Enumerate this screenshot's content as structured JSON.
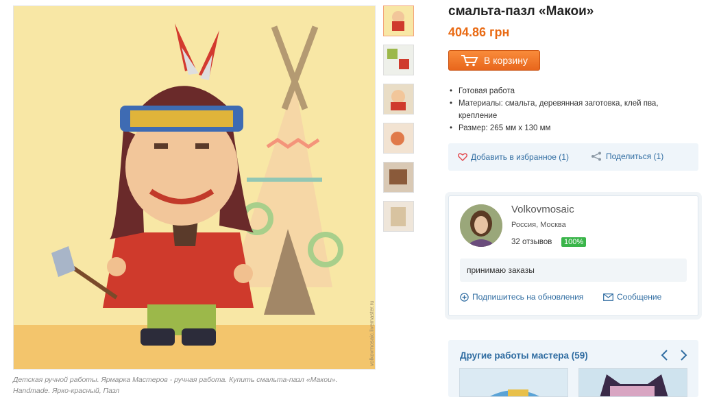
{
  "product": {
    "title": "смальта-пазл «Макои»",
    "price": "404.86 грн",
    "cart_label": "В корзину",
    "details": [
      "Готовая работа",
      "Материалы: смальта, деревянная заготовка, клей пва, крепление",
      "Размер: 265 мм x 130 мм"
    ],
    "image_caption_line1": "Детская ручной работы. Ярмарка Мастеров - ручная работа. Купить смальта-пазл «Макои».",
    "image_caption_line2": "Handmade. Ярко-красный, Пазл",
    "watermark": "volkovmosaic.livemaster.ru"
  },
  "actions": {
    "favorite_label": "Добавить в избранное (1)",
    "share_label": "Поделиться (1)"
  },
  "seller": {
    "name": "Volkovmosaic",
    "location": "Россия, Москва",
    "reviews": "32 отзывов",
    "rating": "100%",
    "bio": "принимаю заказы",
    "subscribe_label": "Подпишитесь на обновления",
    "message_label": "Сообщение"
  },
  "other_works": {
    "title": "Другие работы мастера (59)"
  },
  "colors": {
    "accent_orange": "#e96a13",
    "link_blue": "#2f6ca1",
    "rating_green": "#3ab54a"
  }
}
